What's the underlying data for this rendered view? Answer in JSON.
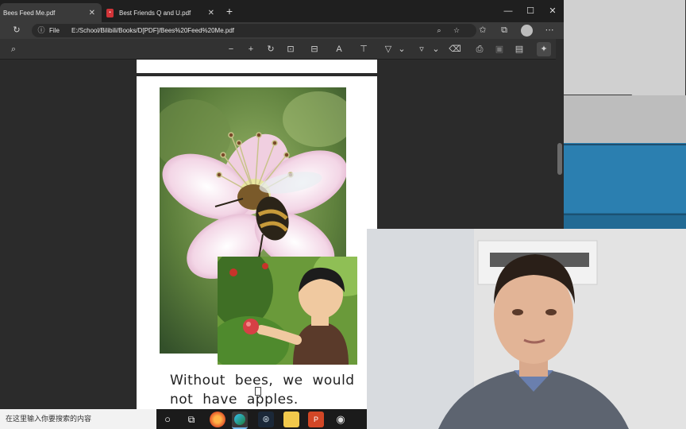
{
  "tabs": [
    {
      "label": "Bees Feed Me.pdf",
      "active": true
    },
    {
      "label": "Best Friends Q and U.pdf",
      "active": false
    }
  ],
  "address": {
    "scheme_label": "File",
    "url": "E:/School/Bilibili/Books/D[PDF]/Bees%20Feed%20Me.pdf"
  },
  "page": {
    "caption_line1": "Without bees, we would",
    "caption_line2": "not have apples."
  },
  "taskbar": {
    "search_placeholder": "在这里输入你要搜索的内容"
  },
  "colors": {
    "chrome_dark": "#1f1f1f",
    "toolbar": "#323232",
    "viewer_bg": "#2b2b2b",
    "pdf_icon": "#d13438"
  }
}
